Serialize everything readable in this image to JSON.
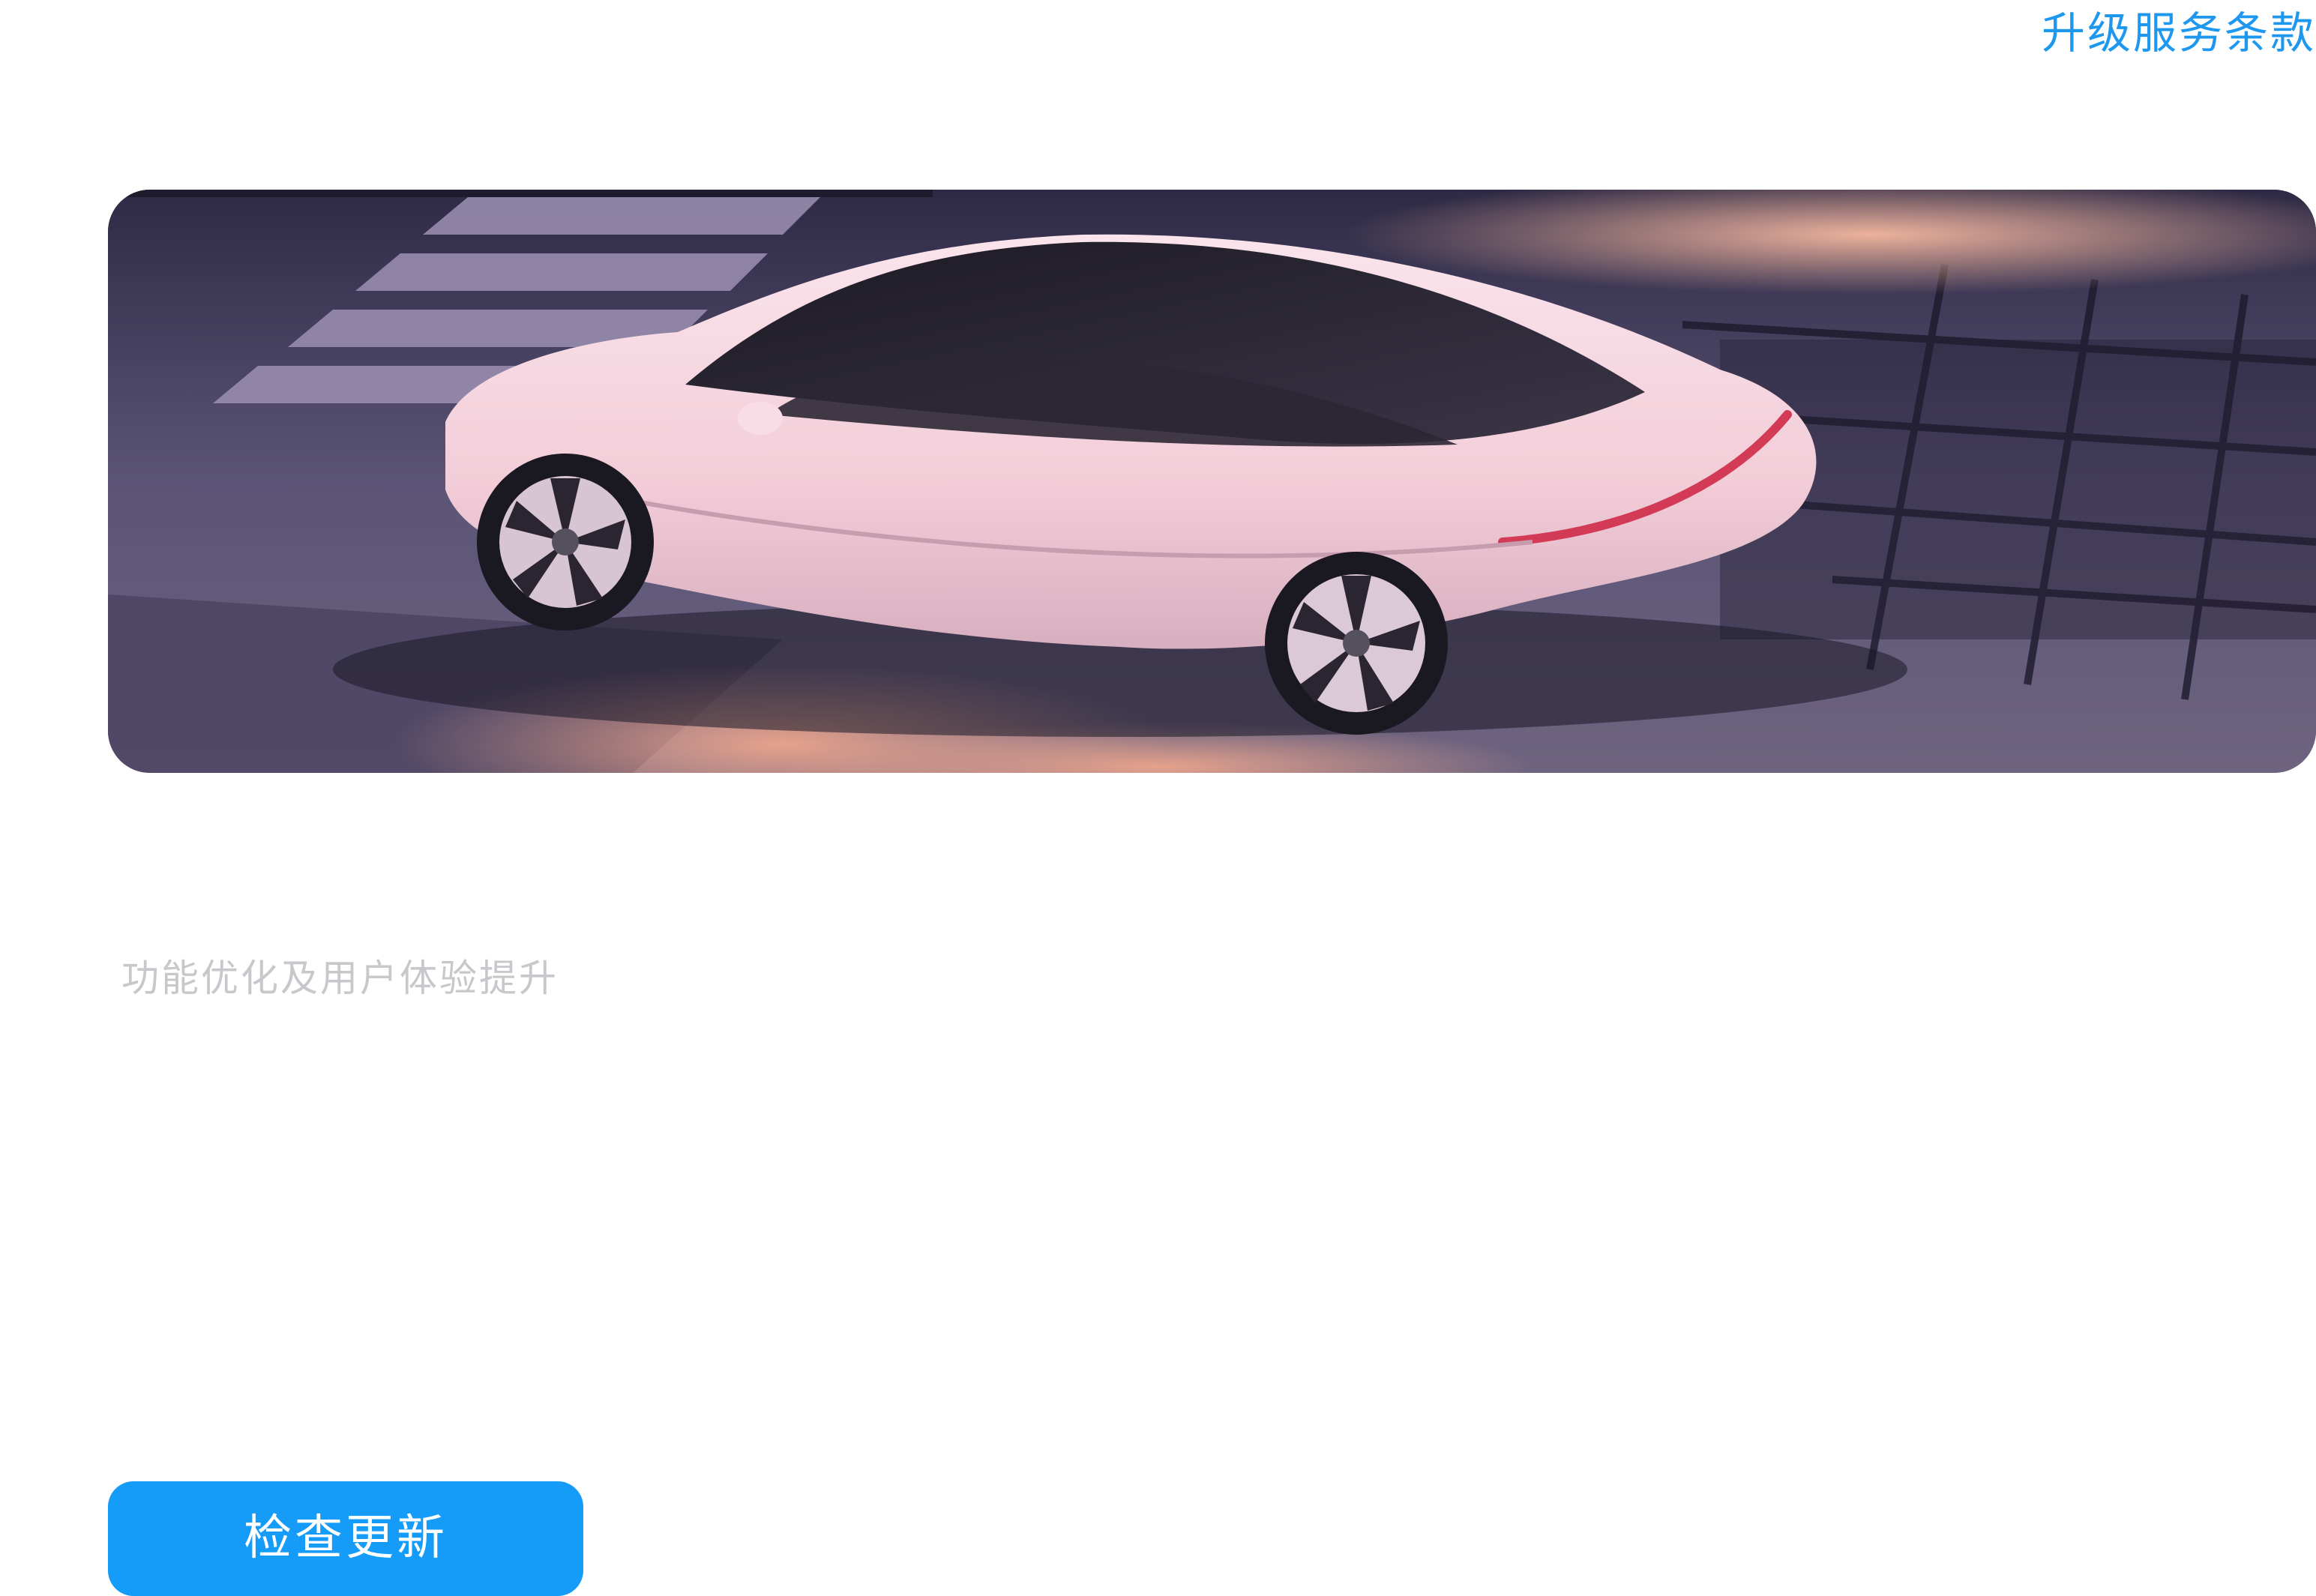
{
  "header": {
    "terms_link": "升级服务条款"
  },
  "hero": {
    "image": "car-hero-image"
  },
  "content": {
    "description": "功能优化及用户体验提升"
  },
  "actions": {
    "check_update": "检查更新"
  },
  "colors": {
    "accent": "#1e97ee",
    "button": "#159bf8",
    "muted_text": "#c8c8cc"
  }
}
